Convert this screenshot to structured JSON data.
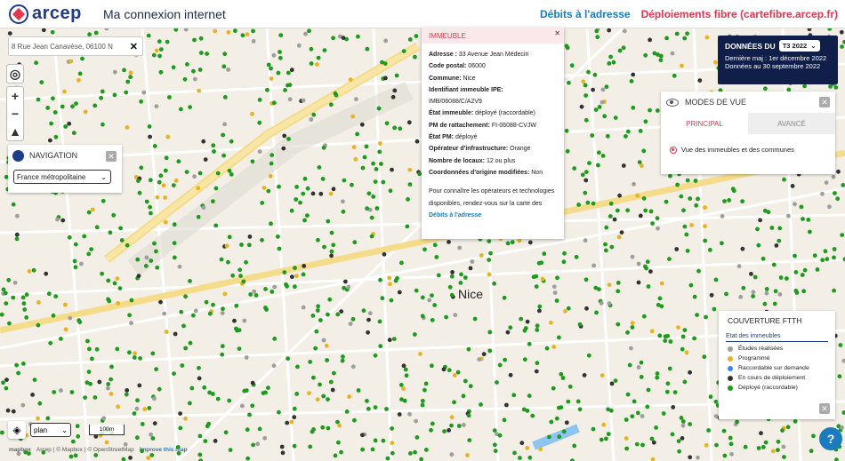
{
  "header": {
    "logo": "arcep",
    "title": "Ma connexion internet",
    "link_debits": "Débits à l'adresse",
    "link_fibre": "Déploiements fibre (cartefibre.arcep.fr)"
  },
  "search": {
    "value": "8 Rue Jean Canavèse, 06100 N"
  },
  "navigation": {
    "title": "NAVIGATION",
    "select_value": "France métropolitaine"
  },
  "popup": {
    "title": "IMMEUBLE",
    "rows": [
      {
        "label": "Adresse :",
        "value": "33 Avenue Jean Médecin"
      },
      {
        "label": "Code postal:",
        "value": "06000"
      },
      {
        "label": "Commune:",
        "value": "Nice"
      },
      {
        "label": "Identifiant immeuble IPE:",
        "value": ""
      },
      {
        "label": "",
        "value": "IMB/06088/C/A2V9"
      },
      {
        "label": "État immeuble:",
        "value": "déployé (raccordable)"
      },
      {
        "label": "PM de rattachement:",
        "value": "FI-06088-CVJW"
      },
      {
        "label": "État PM:",
        "value": "déployé"
      },
      {
        "label": "Opérateur d'infrastructure:",
        "value": "Orange"
      },
      {
        "label": "Nombre de locaux:",
        "value": "12 ou plus"
      },
      {
        "label": "Coordonnées d'origine modifiées:",
        "value": "Non"
      }
    ],
    "footer_text": "Pour connaître les opérateurs et technologies disponibles, rendez-vous sur la carte des",
    "footer_link": "Débits à l'adresse"
  },
  "donnees": {
    "label": "DONNÉES DU",
    "period": "T3 2022",
    "maj": "Dernière maj : 1er décembre 2022",
    "au": "Données au 30 septembre 2022"
  },
  "modes": {
    "title": "MODES DE VUE",
    "tab_principal": "PRINCIPAL",
    "tab_avance": "AVANCÉ",
    "radio_label": "Vue des immeubles et des communes"
  },
  "couverture": {
    "title": "COUVERTURE FTTH",
    "subtitle": "Etat des immeubles",
    "items": [
      {
        "label": "Études réalisées",
        "color": "#9e9e9e"
      },
      {
        "label": "Programmé",
        "color": "#e6b422"
      },
      {
        "label": "Raccordable sur demande",
        "color": "#3b82f6"
      },
      {
        "label": "En cours de déploiement",
        "color": "#333333"
      },
      {
        "label": "Déployé (raccordable)",
        "color": "#1e9b1e"
      }
    ]
  },
  "map": {
    "city": "Nice",
    "layer": "plan",
    "scale": "100m"
  },
  "attribution": {
    "mapbox": "mapbox",
    "credits": "Arcep | © Mapbox | © OpenStreetMap",
    "improve": "Improve this map"
  },
  "help_symbol": "?"
}
